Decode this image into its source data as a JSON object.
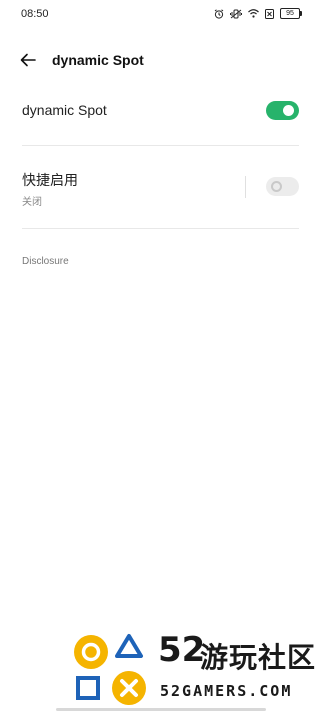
{
  "status_bar": {
    "time": "08:50",
    "battery": "95"
  },
  "header": {
    "title": "dynamic Spot"
  },
  "main_setting": {
    "label": "dynamic Spot",
    "state": "on"
  },
  "quick_enable": {
    "label": "快捷启用",
    "status": "关闭",
    "state": "off"
  },
  "footer": {
    "disclosure": "Disclosure"
  },
  "watermark": {
    "number": "52",
    "name": "游玩社区",
    "site": "52GAMERS.COM"
  },
  "colors": {
    "accent": "#27b36b",
    "toggle_off": "#ececec",
    "watermark_yellow": "#f5b400",
    "watermark_blue": "#1e63b8"
  }
}
